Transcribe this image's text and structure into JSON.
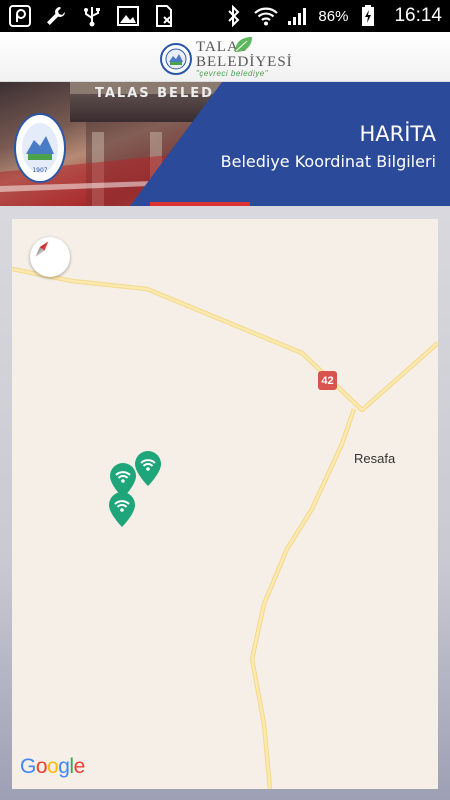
{
  "status_bar": {
    "battery_percent": "86%",
    "time": "16:14",
    "left_icons": [
      "notification-p-icon",
      "wrench-icon",
      "usb-icon",
      "image-icon",
      "sim-off-icon"
    ],
    "right_icons": [
      "bluetooth-icon",
      "wifi-icon",
      "signal-icon",
      "battery-charging-icon"
    ]
  },
  "header": {
    "logo_line1": "TALAS",
    "logo_line2": "BELEDİYESİ",
    "logo_tagline": "\"çevreci belediye\""
  },
  "banner": {
    "title": "HARİTA",
    "subtitle": "Belediye Koordinat Bilgileri",
    "building_sign": "TALAS BELED",
    "accent_color": "#2c4a9a"
  },
  "map": {
    "road_shield": "42",
    "place_label": "Resafa",
    "google_logo": [
      "G",
      "o",
      "o",
      "g",
      "l",
      "e"
    ],
    "google_colors": [
      "#4285F4",
      "#EA4335",
      "#FBBC05",
      "#4285F4",
      "#34A853",
      "#EA4335"
    ],
    "marker_icon": "wifi-marker-icon",
    "marker_count": 3
  }
}
